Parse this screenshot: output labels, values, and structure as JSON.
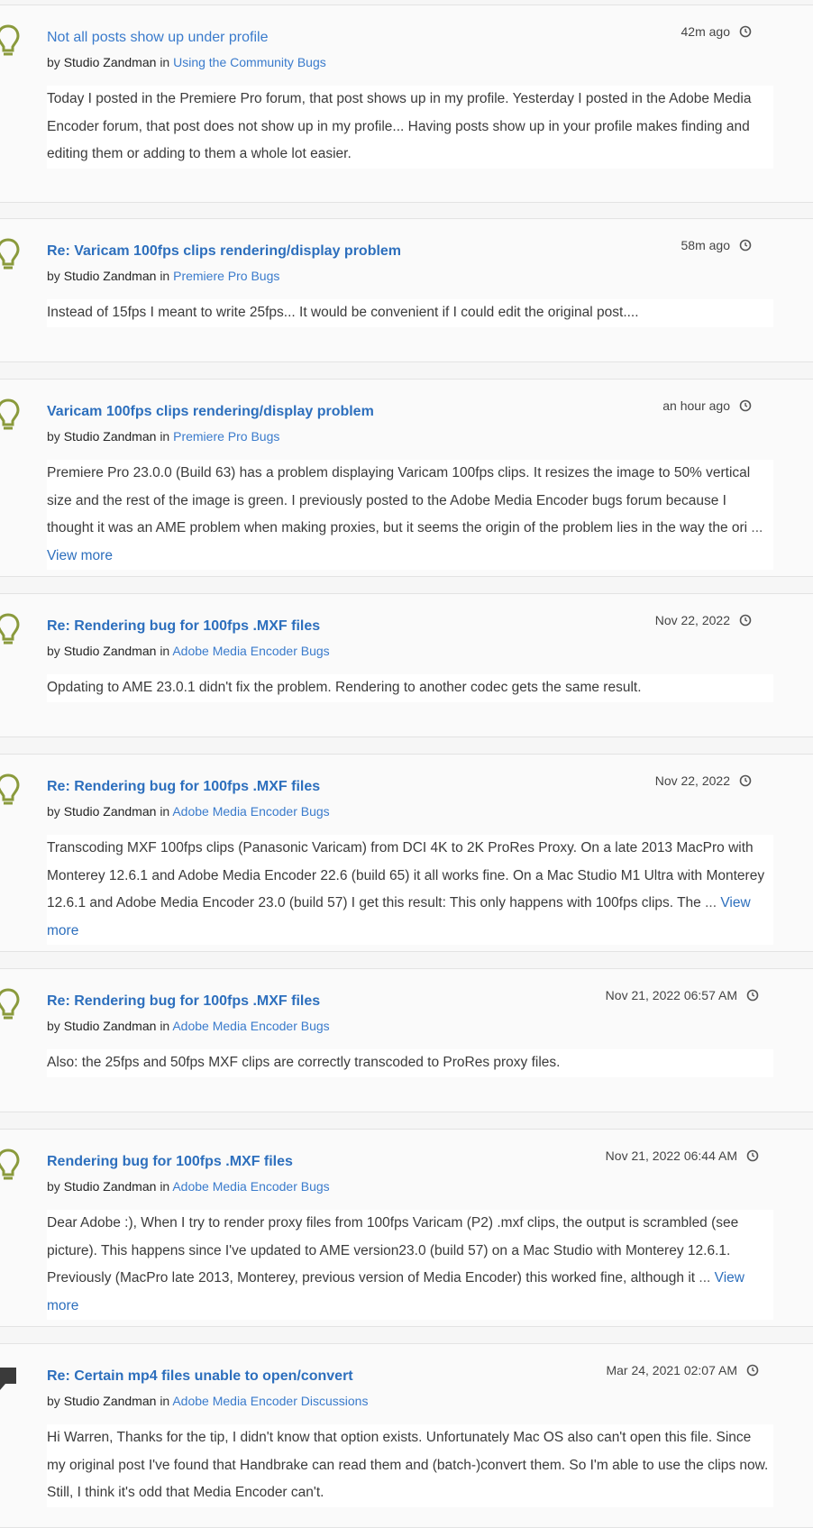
{
  "posts": [
    {
      "icon": "lightbulb-icon",
      "title": "Not all posts show up under profile",
      "by": "by",
      "author": "Studio Zandman",
      "in": "in",
      "board": "Using the Community Bugs",
      "time": "42m ago",
      "body": "Today I posted in the Premiere Pro forum, that post shows up in my profile.   Yesterday I posted in the Adobe Media Encoder forum, that post does not show up in my profile...   Having posts show up in your profile makes finding and editing them or adding to them a whole lot easier.",
      "ellipsis": "",
      "view_more": ""
    },
    {
      "icon": "lightbulb-icon",
      "title": "Re: Varicam 100fps clips rendering/display problem",
      "by": "by",
      "author": "Studio Zandman",
      "in": "in",
      "board": "Premiere Pro Bugs",
      "time": "58m ago",
      "body": "Instead of 15fps I meant to write 25fps...   It would be convenient if I could edit the original post....",
      "ellipsis": "",
      "view_more": ""
    },
    {
      "icon": "lightbulb-icon",
      "title": "Varicam 100fps clips rendering/display problem",
      "by": "by",
      "author": "Studio Zandman",
      "in": "in",
      "board": "Premiere Pro Bugs",
      "time": "an hour ago",
      "body": "Premiere Pro 23.0.0 (Build 63) has a problem displaying Varicam 100fps clips. It resizes the image to 50% vertical size and the rest of the image is green.     I previously posted to the Adobe Media Encoder bugs forum because I thought it was an AME problem when making proxies, but it seems the origin of the problem lies in the way the ori",
      "ellipsis": " ... ",
      "view_more": "View more"
    },
    {
      "icon": "lightbulb-icon",
      "title": "Re: Rendering bug for 100fps .MXF files",
      "by": "by",
      "author": "Studio Zandman",
      "in": "in",
      "board": "Adobe Media Encoder Bugs",
      "time": "Nov 22, 2022",
      "body": "Opdating to AME 23.0.1 didn't fix the problem. Rendering to another codec gets the same result.",
      "ellipsis": "",
      "view_more": ""
    },
    {
      "icon": "lightbulb-icon",
      "title": "Re: Rendering bug for 100fps .MXF files",
      "by": "by",
      "author": "Studio Zandman",
      "in": "in",
      "board": "Adobe Media Encoder Bugs",
      "time": "Nov 22, 2022",
      "body": "Transcoding MXF 100fps clips (Panasonic Varicam) from DCI 4K to 2K ProRes Proxy.   On a late 2013 MacPro with Monterey 12.6.1 and Adobe Media Encoder 22.6 (build 65) it all works fine. On a Mac Studio M1 Ultra with Monterey 12.6.1 and Adobe Media Encoder 23.0 (build 57) I get this result:   This only happens with 100fps clips. The",
      "ellipsis": " ... ",
      "view_more": "View more"
    },
    {
      "icon": "lightbulb-icon",
      "title": "Re: Rendering bug for 100fps .MXF files",
      "by": "by",
      "author": "Studio Zandman",
      "in": "in",
      "board": "Adobe Media Encoder Bugs",
      "time": "Nov 21, 2022 06:57 AM",
      "body": "Also: the 25fps and 50fps MXF clips are correctly transcoded to ProRes proxy files.",
      "ellipsis": "",
      "view_more": ""
    },
    {
      "icon": "lightbulb-icon",
      "title": "Rendering bug for 100fps .MXF files",
      "by": "by",
      "author": "Studio Zandman",
      "in": "in",
      "board": "Adobe Media Encoder Bugs",
      "time": "Nov 21, 2022 06:44 AM",
      "body": "Dear Adobe :), When I try to render proxy files from 100fps Varicam (P2) .mxf clips, the output is scrambled (see picture). This happens since I've updated to AME version23.0 (build 57) on a Mac Studio with Monterey 12.6.1. Previously (MacPro late 2013, Monterey, previous version of Media Encoder) this worked fine, although it",
      "ellipsis": " ... ",
      "view_more": "View more"
    },
    {
      "icon": "speech-bubble-icon",
      "title": "Re: Certain mp4 files unable to open/convert",
      "by": "by",
      "author": "Studio Zandman",
      "in": "in",
      "board": "Adobe Media Encoder Discussions",
      "time": "Mar 24, 2021 02:07 AM",
      "body": "Hi Warren,   Thanks for the tip, I didn't know that option exists. Unfortunately Mac OS also can't open this file.   Since my original post I've found that Handbrake can read them and (batch-)convert them. So I'm able to use the clips now.   Still, I think it's odd that Media Encoder can't.",
      "ellipsis": "",
      "view_more": ""
    }
  ],
  "colors": {
    "link": "#2d6fbd",
    "icon_green": "#8a9a3c",
    "icon_dark": "#3a3a3a"
  }
}
